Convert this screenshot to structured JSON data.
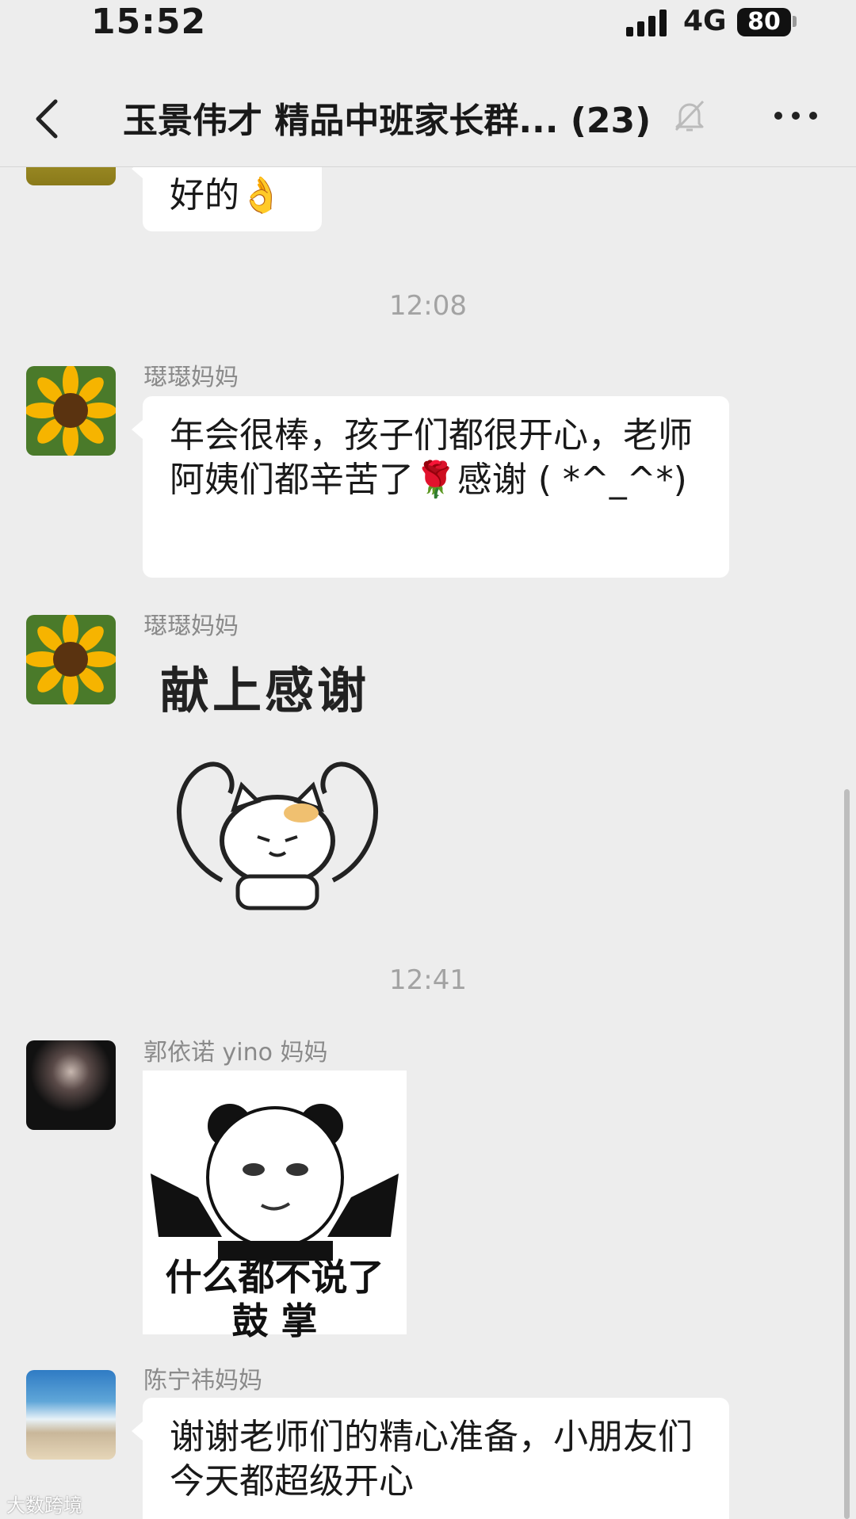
{
  "status_bar": {
    "time": "15:52",
    "network": "4G",
    "battery": "80"
  },
  "header": {
    "back_icon": "chevron-left-icon",
    "title": "玉景伟才 精品中班家长群...  (23)",
    "mute_icon": "bell-slash-icon",
    "more_icon": "more-dots-icon"
  },
  "messages": [
    {
      "text": "好的👌"
    },
    {
      "timestamp": "12:08"
    },
    {
      "sender": "璱璱妈妈",
      "text": "年会很棒，孩子们都很开心，老师阿姨们都辛苦了🌹感谢 (  *^_^*)"
    },
    {
      "sender": "璱璱妈妈",
      "sticker_text": "献上感谢"
    },
    {
      "timestamp": "12:41"
    },
    {
      "sender": "郭依诺 yino 妈妈",
      "sticker_text_line1": "什么都不说了",
      "sticker_text_line2": "鼓 掌"
    },
    {
      "sender": "陈宁祎妈妈",
      "text": "谢谢老师们的精心准备，小朋友们今天都超级开心"
    }
  ],
  "watermark": "大数跨境"
}
